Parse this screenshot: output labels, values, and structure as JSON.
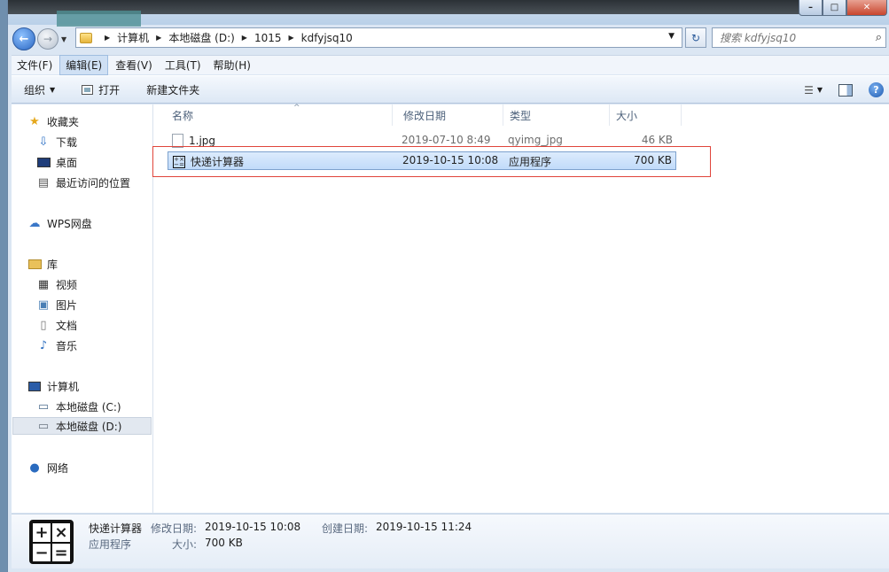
{
  "window": {
    "controls": {
      "minimize": "–",
      "maximize": "□",
      "close": "✕"
    }
  },
  "nav": {
    "back_icon": "←",
    "forward_icon": "→",
    "dropdown_icon": "▼",
    "breadcrumbs": [
      "计算机",
      "本地磁盘 (D:)",
      "1015",
      "kdfyjsq10"
    ],
    "refresh_icon": "↻",
    "search_placeholder": "搜索 kdfyjsq10"
  },
  "menubar": {
    "items": [
      "文件(F)",
      "编辑(E)",
      "查看(V)",
      "工具(T)",
      "帮助(H)"
    ],
    "active_index": 1
  },
  "toolbar": {
    "organize": "组织",
    "open": "打开",
    "new_folder": "新建文件夹",
    "help_icon": "?"
  },
  "navpane": {
    "favorites": {
      "label": "收藏夹",
      "icon": "star-icon"
    },
    "fav_items": [
      {
        "label": "下载",
        "icon": "download-icon"
      },
      {
        "label": "桌面",
        "icon": "desktop-icon"
      },
      {
        "label": "最近访问的位置",
        "icon": "recent-icon"
      }
    ],
    "wps": {
      "label": "WPS网盘",
      "icon": "cloud-icon"
    },
    "libraries": {
      "label": "库",
      "icon": "library-icon"
    },
    "lib_items": [
      {
        "label": "视频",
        "icon": "video-icon"
      },
      {
        "label": "图片",
        "icon": "picture-icon"
      },
      {
        "label": "文档",
        "icon": "document-icon"
      },
      {
        "label": "音乐",
        "icon": "music-icon"
      }
    ],
    "computer": {
      "label": "计算机",
      "icon": "computer-icon"
    },
    "drives": [
      {
        "label": "本地磁盘 (C:)",
        "icon": "drive-c-icon"
      },
      {
        "label": "本地磁盘 (D:)",
        "icon": "drive-d-icon",
        "selected": true
      }
    ],
    "network": {
      "label": "网络",
      "icon": "network-icon"
    }
  },
  "files": {
    "columns": {
      "name": "名称",
      "date": "修改日期",
      "type": "类型",
      "size": "大小"
    },
    "rows": [
      {
        "name": "1.jpg",
        "date": "2019-07-10 8:49",
        "type": "qyimg_jpg",
        "size": "46 KB",
        "icon": "image-file-icon"
      },
      {
        "name": "快递计算器",
        "date": "2019-10-15 10:08",
        "type": "应用程序",
        "size": "700 KB",
        "icon": "calculator-icon",
        "selected": true
      }
    ],
    "highlight_color": "#e0453b"
  },
  "details": {
    "name": "快递计算器",
    "type": "应用程序",
    "modified_label": "修改日期:",
    "modified_value": "2019-10-15 10:08",
    "created_label": "创建日期:",
    "created_value": "2019-10-15 11:24",
    "size_label": "大小:",
    "size_value": "700 KB",
    "calc_symbols": [
      "+",
      "×",
      "−",
      "="
    ]
  }
}
